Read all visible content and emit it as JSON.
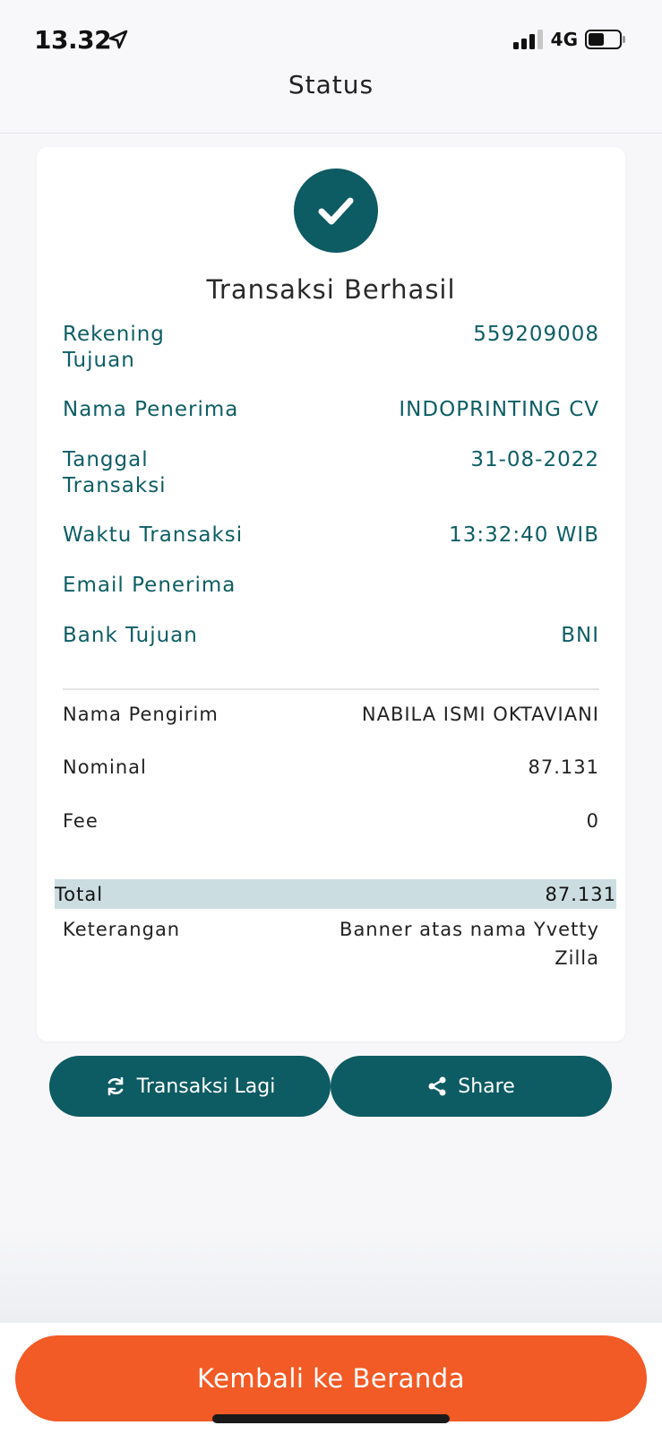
{
  "status_bar": {
    "time": "13.32",
    "network": "4G",
    "icons": [
      "location-arrow-icon",
      "signal-icon",
      "battery-icon"
    ]
  },
  "header": {
    "title": "Status"
  },
  "result": {
    "icon": "checkmark-icon",
    "title": "Transaksi Berhasil"
  },
  "details": [
    {
      "label": "Rekening Tujuan",
      "value": "559209008"
    },
    {
      "label": "Nama Penerima",
      "value": "INDOPRINTING CV"
    },
    {
      "label": "Tanggal Transaksi",
      "value": "31-08-2022"
    },
    {
      "label": "Waktu Transaksi",
      "value": "13:32:40 WIB"
    },
    {
      "label": "Email Penerima",
      "value": ""
    },
    {
      "label": "Bank Tujuan",
      "value": "BNI"
    }
  ],
  "summary": [
    {
      "label": "Nama Pengirim",
      "value": "NABILA ISMI OKTAVIANI"
    },
    {
      "label": "Nominal",
      "value": "87.131"
    },
    {
      "label": "Fee",
      "value": "0"
    }
  ],
  "total": {
    "label": "Total",
    "value": "87.131"
  },
  "note": {
    "label": "Keterangan",
    "value": "Banner atas nama Yvetty Zilla"
  },
  "actions": {
    "again_label": "Transaksi Lagi",
    "again_icon": "refresh-icon",
    "share_label": "Share",
    "share_icon": "share-icon"
  },
  "footer": {
    "home_label": "Kembali ke Beranda"
  },
  "colors": {
    "primary": "#0d5b63",
    "accent": "#f25a26",
    "total_highlight": "#ccdde1"
  }
}
